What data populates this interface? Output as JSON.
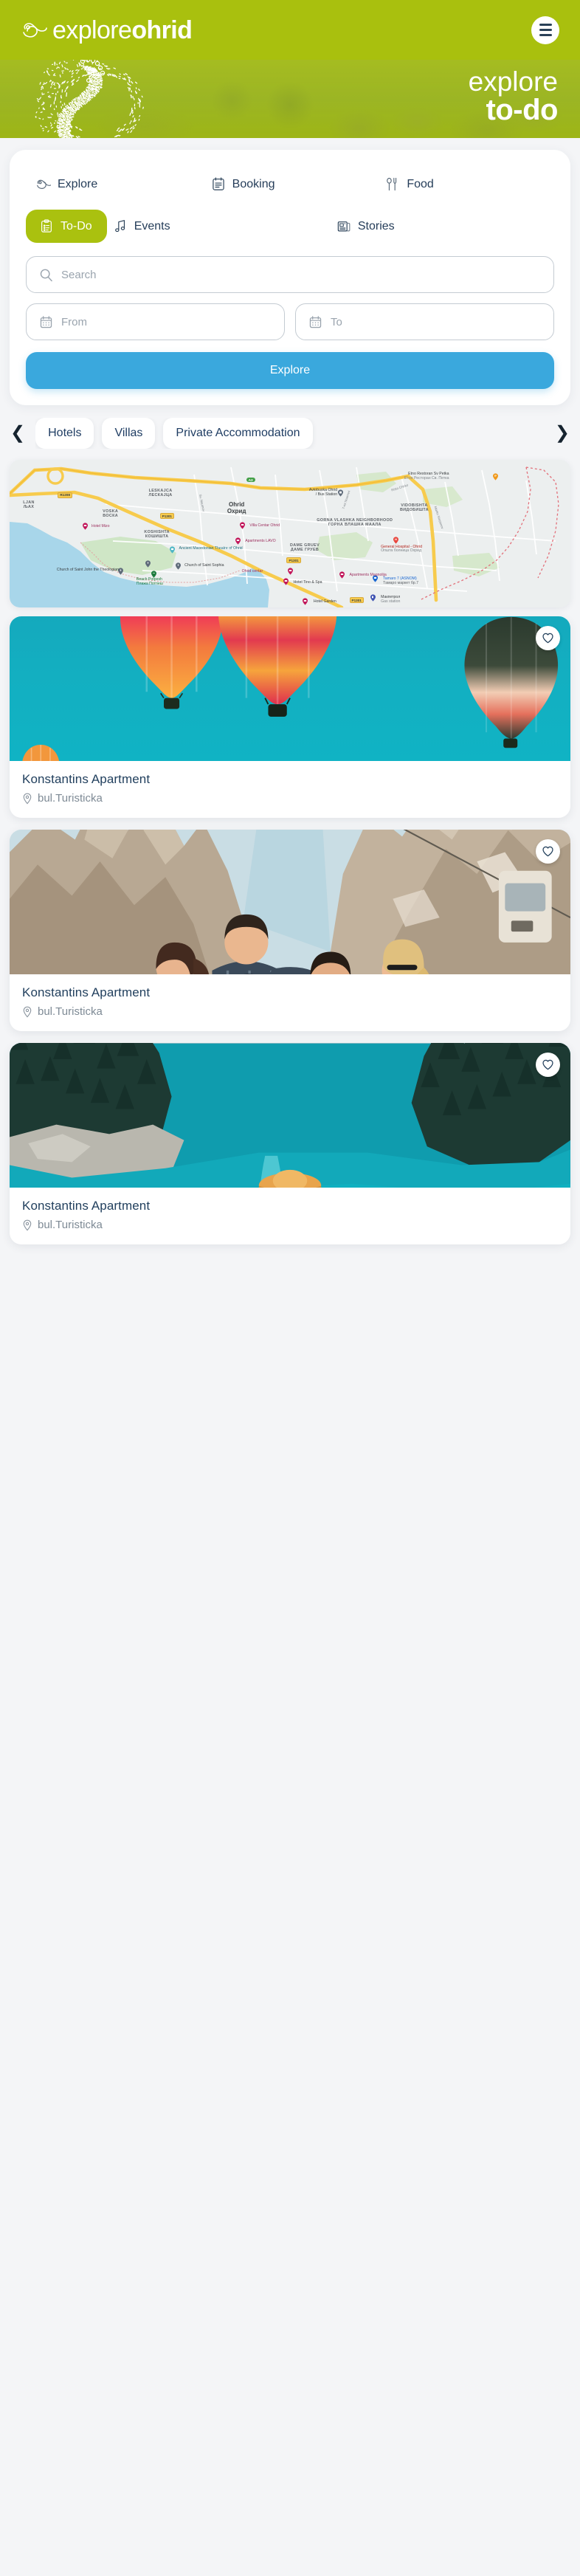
{
  "header": {
    "logo_light": "explore",
    "logo_bold": "ohrid",
    "logo_icon": "swirl-leaf-icon",
    "menu_icon": "hamburger-menu-icon"
  },
  "hero": {
    "title_light": "explore",
    "title_bold": "to-do",
    "artwork": "dotted-peacock-graphic",
    "bg_color": "#a3bc14"
  },
  "tabs": {
    "row1": [
      {
        "label": "Explore",
        "icon": "swirl-leaf-icon",
        "active": false
      },
      {
        "label": "Booking",
        "icon": "clipboard-calendar-icon",
        "active": false
      },
      {
        "label": "Food",
        "icon": "fork-spoon-icon",
        "active": false
      }
    ],
    "row2": [
      {
        "label": "To-Do",
        "icon": "checklist-clipboard-icon",
        "active": true
      },
      {
        "label": "Events",
        "icon": "music-note-icon",
        "active": false
      },
      {
        "label": "Stories",
        "icon": "newspaper-icon",
        "active": false
      }
    ]
  },
  "search": {
    "placeholder": "Search",
    "value": "",
    "icon": "search-icon",
    "from": {
      "placeholder": "From",
      "value": "",
      "icon": "calendar-icon"
    },
    "to": {
      "placeholder": "To",
      "value": "",
      "icon": "calendar-icon"
    },
    "submit_label": "Explore",
    "submit_color": "#3aa8dd"
  },
  "chips": {
    "prev_icon": "chevron-left-icon",
    "next_icon": "chevron-right-icon",
    "items": [
      "Hotels",
      "Villas",
      "Private Accommodation"
    ]
  },
  "map": {
    "city": {
      "latin": "Ohrid",
      "cyrillic": "Охрид"
    },
    "neighborhoods": [
      {
        "latin": "LESKAJCA",
        "cyrillic": "ЛЕСКАЈЦА"
      },
      {
        "latin": "VOSKA",
        "cyrillic": "ВОСКА"
      },
      {
        "latin": "KOSHISHTA",
        "cyrillic": "КОШИШТА"
      },
      {
        "latin": "VIDOBISHTA",
        "cyrillic": "ВИДОБИШТА"
      },
      {
        "latin": "GORNA VLASHKA NEIGHBORHOOD",
        "cyrillic": "ГОРНА ВЛАШКА МААЛА"
      },
      {
        "latin": "DAME GRUEV",
        "cyrillic": "ДАМЕ ГРУЕВ"
      },
      {
        "latin": "LJAN",
        "cyrillic": "ЉАХ"
      }
    ],
    "pois": [
      {
        "name": "Etno Restoran Sv Petka",
        "sub": "Етно Ресторан Св. Петка",
        "kind": "restaurant"
      },
      {
        "name": "Avtobuska Ohrid",
        "sub": "/ Bus Station",
        "kind": "transit"
      },
      {
        "name": "Villa Centar Ohrid",
        "sub": "",
        "kind": "lodging"
      },
      {
        "name": "Hotel Mizo",
        "sub": "",
        "kind": "lodging"
      },
      {
        "name": "Apartments LAVO",
        "sub": "",
        "kind": "lodging"
      },
      {
        "name": "Ancient Macedonian Theatre of Ohrid",
        "sub": "",
        "kind": "attraction"
      },
      {
        "name": "General Hospital - Ohrid",
        "sub": "Општа болница Охрид",
        "kind": "hospital"
      },
      {
        "name": "Church of Saint Sophia",
        "sub": "",
        "kind": "church"
      },
      {
        "name": "Church of Saint John the Theologian",
        "sub": "",
        "kind": "church"
      },
      {
        "name": "Ohrid centar",
        "sub": "",
        "kind": "lodging"
      },
      {
        "name": "Apartments Magnolija",
        "sub": "",
        "kind": "lodging"
      },
      {
        "name": "Beach Potpesh",
        "sub": "Плажа Потпеш",
        "kind": "beach"
      },
      {
        "name": "Hotel Tino & Spa",
        "sub": "",
        "kind": "lodging"
      },
      {
        "name": "Tamaro 7 (ASNOM)",
        "sub": "Тамаро маркет бр.7",
        "kind": "store"
      },
      {
        "name": "Hotel Garden",
        "sub": "",
        "kind": "lodging"
      },
      {
        "name": "Макпетрол",
        "sub": "Gas station",
        "kind": "gas"
      }
    ],
    "roads": [
      "R1208",
      "P1301",
      "P1301",
      "P1301",
      "A3"
    ],
    "streets": [
      "Sv. Naumov",
      "7-mi Noemvri",
      "Risto Chirko",
      "Marko Stepanov"
    ]
  },
  "listings": [
    {
      "title": "Konstantins Apartment",
      "location": "bul.Turisticka",
      "location_icon": "map-pin-icon",
      "fav_icon": "heart-icon",
      "image": "hot-air-balloons-teal-sky"
    },
    {
      "title": "Konstantins Apartment",
      "location": "bul.Turisticka",
      "location_icon": "map-pin-icon",
      "fav_icon": "heart-icon",
      "image": "hikers-in-canyon"
    },
    {
      "title": "Konstantins Apartment",
      "location": "bul.Turisticka",
      "location_icon": "map-pin-icon",
      "fav_icon": "heart-icon",
      "image": "person-at-turquoise-mountain-lake"
    }
  ]
}
